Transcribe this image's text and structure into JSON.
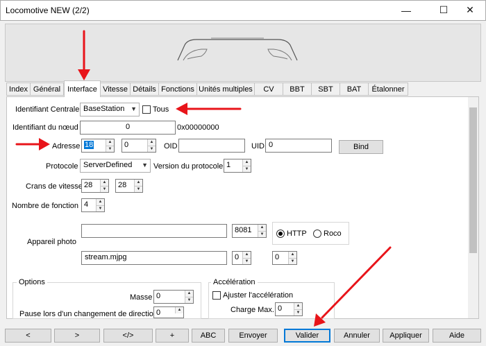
{
  "window": {
    "title": "Locomotive NEW (2/2)",
    "minimize_glyph": "—",
    "maximize_glyph": "☐",
    "close_glyph": "✕"
  },
  "tabs": [
    {
      "label": "Index"
    },
    {
      "label": "Général"
    },
    {
      "label": "Interface",
      "active": true
    },
    {
      "label": "Vitesse"
    },
    {
      "label": "Détails"
    },
    {
      "label": "Fonctions"
    },
    {
      "label": "Unités multiples"
    },
    {
      "label": "CV"
    },
    {
      "label": "BBT"
    },
    {
      "label": "SBT"
    },
    {
      "label": "BAT"
    },
    {
      "label": "Étalonner"
    }
  ],
  "form": {
    "central_id_label": "Identifiant Centrale",
    "central_id_value": "BaseStation",
    "tous_label": "Tous",
    "node_id_label": "Identifiant du nœud",
    "node_id_value": "0",
    "node_hex": "0x00000000",
    "address_label": "Adresse",
    "address_value": "18",
    "address_second_value": "0",
    "oid_label": "OID",
    "oid_value": "",
    "uid_label": "UID",
    "uid_value": "0",
    "bind_label": "Bind",
    "protocol_label": "Protocole",
    "protocol_value": "ServerDefined",
    "protocol_version_label": "Version du protocole",
    "protocol_version_value": "1",
    "speed_steps_label": "Crans de vitesse",
    "speed_steps_value1": "28",
    "speed_steps_value2": "28",
    "function_count_label": "Nombre de fonction",
    "function_count_value": "4",
    "camera_label": "Appareil photo",
    "camera_host_value": "",
    "camera_port_value": "8081",
    "http_label": "HTTP",
    "roco_label": "Roco",
    "stream_value": "stream.mjpg",
    "stream_spin1_value": "0",
    "stream_spin2_value": "0"
  },
  "options_group": {
    "title": "Options",
    "mass_label": "Masse",
    "mass_value": "0",
    "pause_label": "Pause lors d'un changement de direction",
    "pause_value": "0"
  },
  "acceleration_group": {
    "title": "Accélération",
    "adjust_label": "Ajuster l'accélération",
    "max_load_label": "Charge Max.",
    "max_load_value": "0"
  },
  "bottom_buttons": {
    "first": "<",
    "prev": ">",
    "code": "</>",
    "add": "+",
    "abc": "ABC",
    "send": "Envoyer",
    "validate": "Valider",
    "cancel": "Annuler",
    "apply": "Appliquer",
    "help": "Aide"
  },
  "colors": {
    "accent": "#0078d7",
    "annotation_arrow": "#e8141a"
  }
}
